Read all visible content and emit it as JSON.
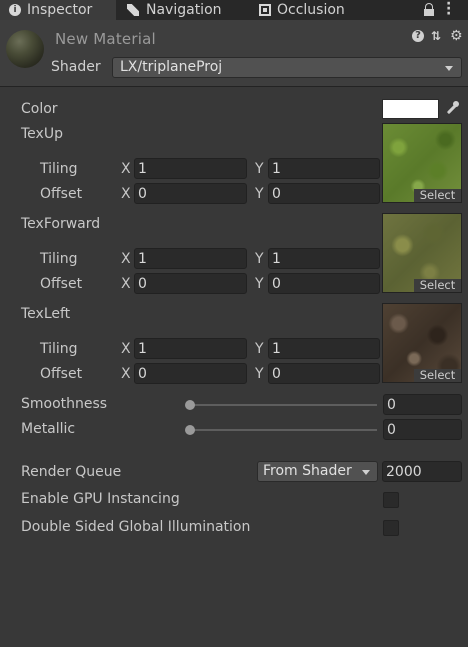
{
  "tabs": [
    {
      "label": "Inspector",
      "icon": "info-icon",
      "active": true
    },
    {
      "label": "Navigation",
      "icon": "navigation-icon",
      "active": false
    },
    {
      "label": "Occlusion",
      "icon": "occlusion-icon",
      "active": false
    }
  ],
  "header": {
    "material_name": "New Material",
    "shader_label": "Shader",
    "shader_value": "LX/triplaneProj"
  },
  "properties": {
    "color_label": "Color",
    "color_value": "#ffffff",
    "textures": [
      {
        "label": "TexUp",
        "tiling": {
          "x": "1",
          "y": "1"
        },
        "offset": {
          "x": "0",
          "y": "0"
        },
        "select": "Select"
      },
      {
        "label": "TexForward",
        "tiling": {
          "x": "1",
          "y": "1"
        },
        "offset": {
          "x": "0",
          "y": "0"
        },
        "select": "Select"
      },
      {
        "label": "TexLeft",
        "tiling": {
          "x": "1",
          "y": "1"
        },
        "offset": {
          "x": "0",
          "y": "0"
        },
        "select": "Select"
      }
    ],
    "tiling_label": "Tiling",
    "offset_label": "Offset",
    "x_label": "X",
    "y_label": "Y",
    "smoothness": {
      "label": "Smoothness",
      "value": "0",
      "fraction": 0
    },
    "metallic": {
      "label": "Metallic",
      "value": "0",
      "fraction": 0
    }
  },
  "advanced": {
    "render_queue_label": "Render Queue",
    "render_queue_mode": "From Shader",
    "render_queue_value": "2000",
    "gpu_instancing_label": "Enable GPU Instancing",
    "gpu_instancing_checked": false,
    "double_sided_gi_label": "Double Sided Global Illumination",
    "double_sided_gi_checked": false
  }
}
